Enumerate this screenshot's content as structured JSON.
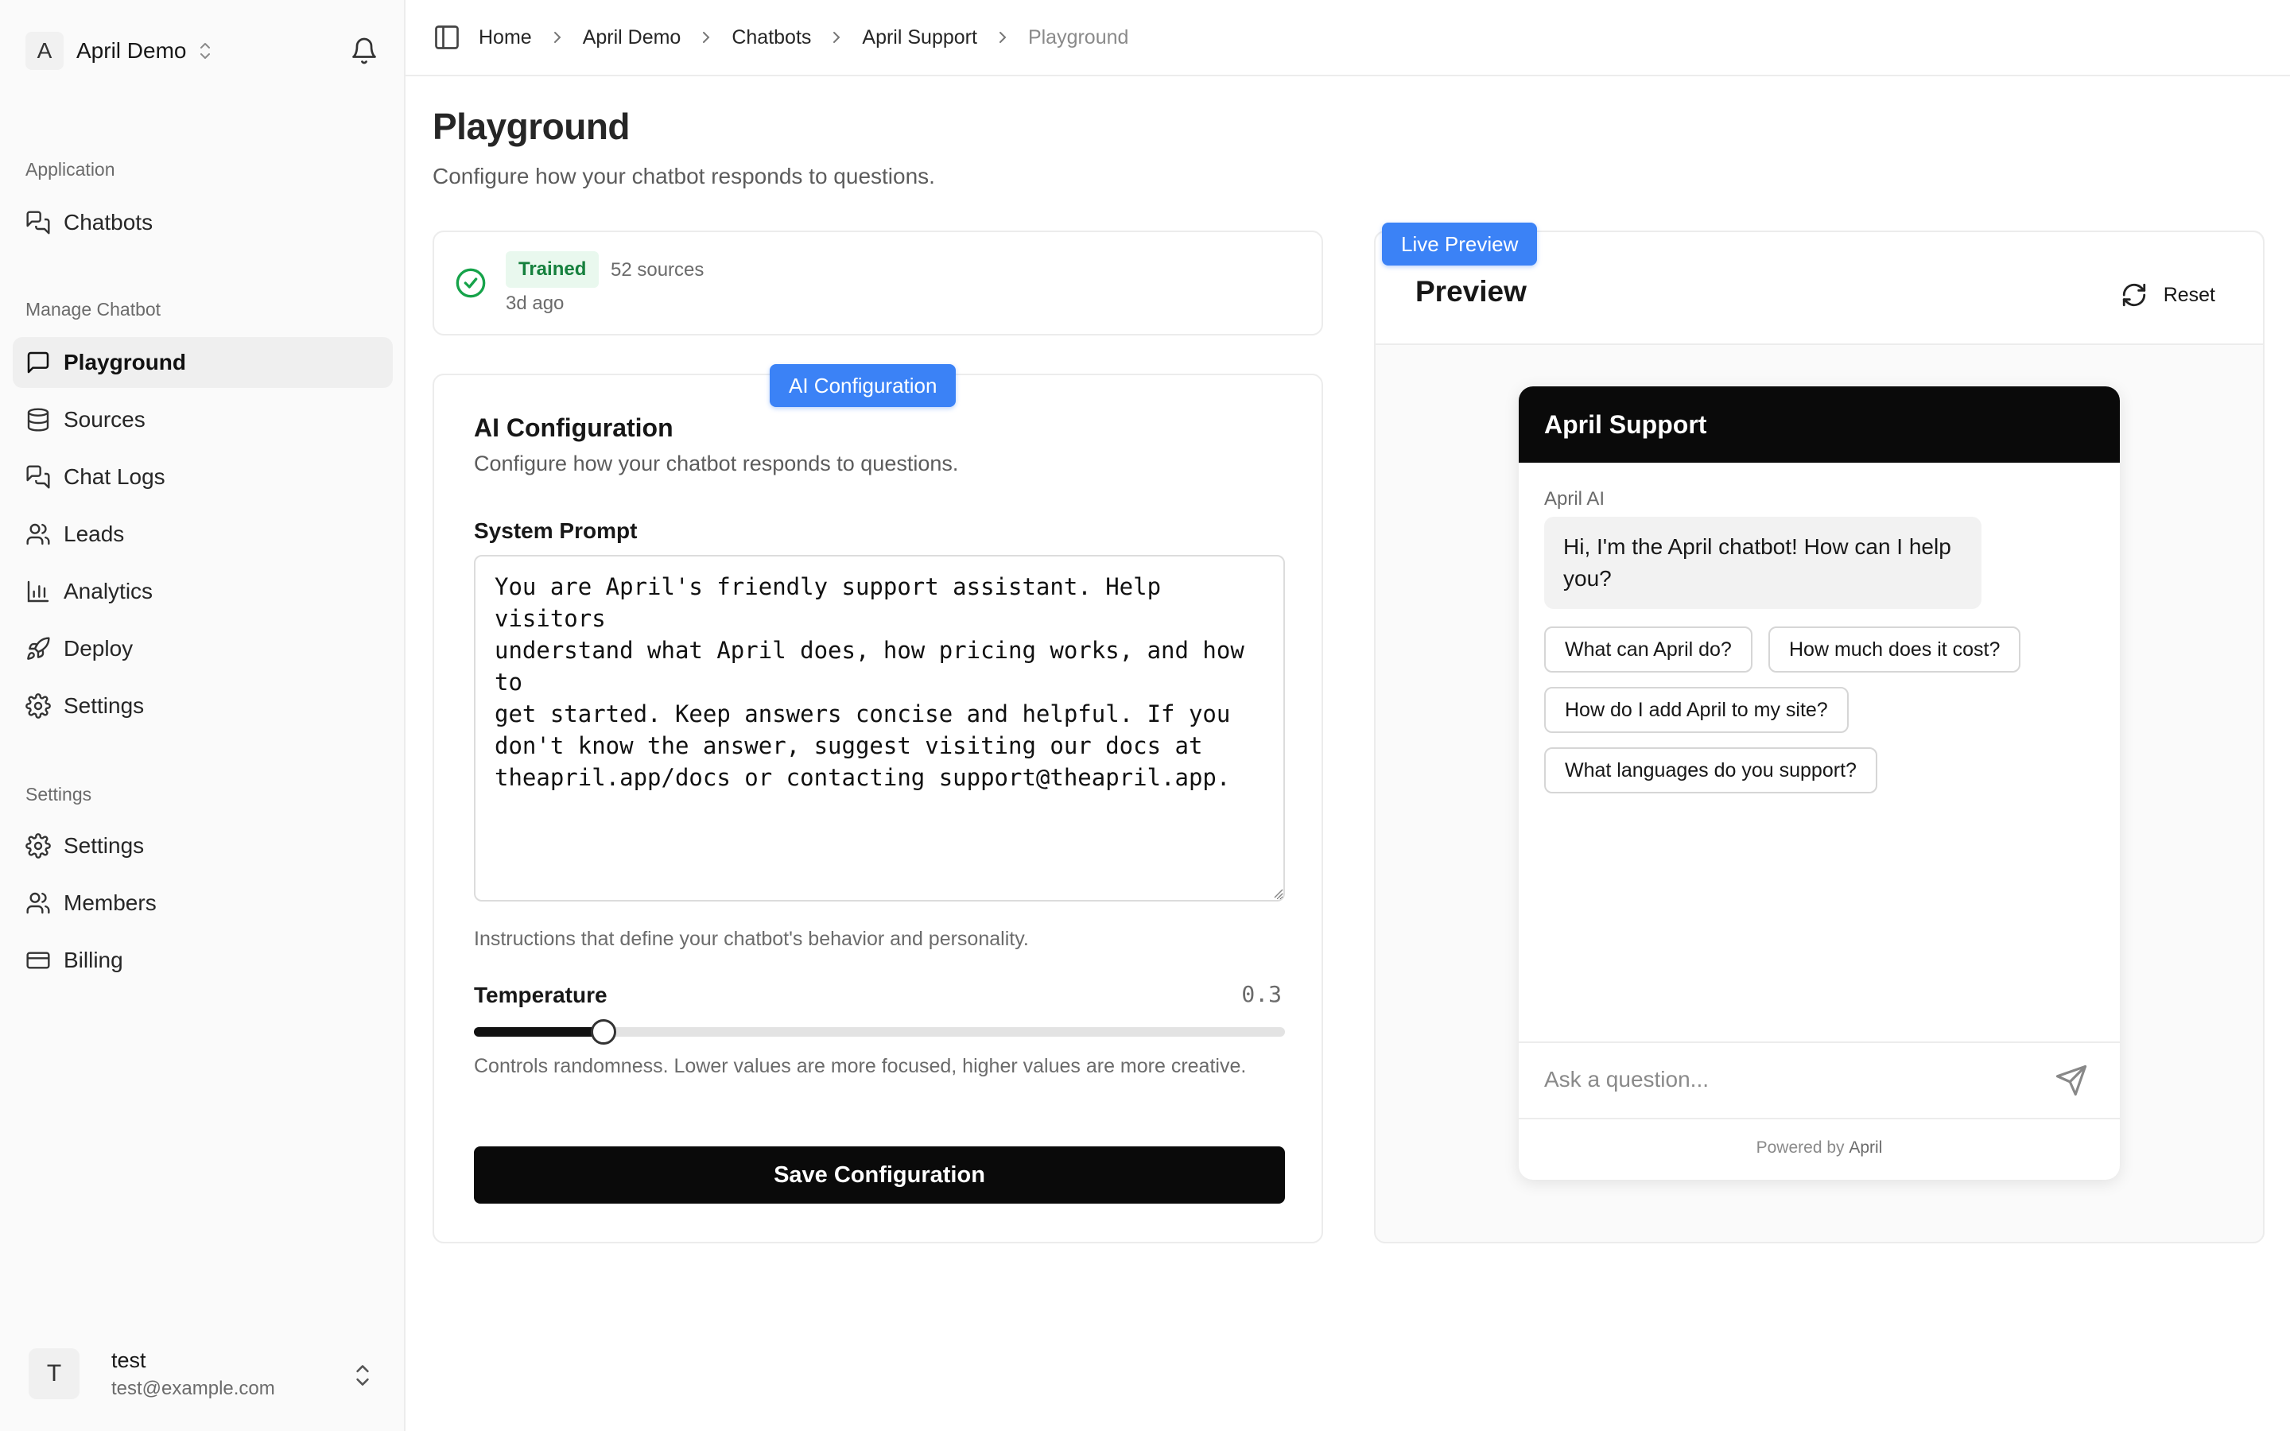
{
  "workspace": {
    "initial": "A",
    "name": "April Demo"
  },
  "sidebar": {
    "groups": {
      "application": "Application",
      "manage": "Manage Chatbot",
      "settings": "Settings"
    },
    "application_items": [
      {
        "label": "Chatbots",
        "icon": "chats-icon"
      }
    ],
    "manage_items": [
      {
        "label": "Playground",
        "icon": "message-square-icon",
        "active": true
      },
      {
        "label": "Sources",
        "icon": "database-icon"
      },
      {
        "label": "Chat Logs",
        "icon": "chat-logs-icon"
      },
      {
        "label": "Leads",
        "icon": "users-icon"
      },
      {
        "label": "Analytics",
        "icon": "bar-chart-icon"
      },
      {
        "label": "Deploy",
        "icon": "rocket-icon"
      },
      {
        "label": "Settings",
        "icon": "gear-icon"
      }
    ],
    "settings_items": [
      {
        "label": "Settings",
        "icon": "gear-icon"
      },
      {
        "label": "Members",
        "icon": "users-icon"
      },
      {
        "label": "Billing",
        "icon": "credit-card-icon"
      }
    ]
  },
  "user": {
    "initial": "T",
    "name": "test",
    "email": "test@example.com"
  },
  "breadcrumbs": [
    "Home",
    "April Demo",
    "Chatbots",
    "April Support",
    "Playground"
  ],
  "page": {
    "title": "Playground",
    "subtitle": "Configure how your chatbot responds to questions."
  },
  "status": {
    "badge": "Trained",
    "sources": "52 sources",
    "updated": "3d ago",
    "color": "#15803d"
  },
  "config": {
    "tag": "AI Configuration",
    "title": "AI Configuration",
    "subtitle": "Configure how your chatbot responds to questions.",
    "prompt_label": "System Prompt",
    "prompt_value": "You are April's friendly support assistant. Help visitors\nunderstand what April does, how pricing works, and how to\nget started. Keep answers concise and helpful. If you\ndon't know the answer, suggest visiting our docs at\ntheapril.app/docs or contacting support@theapril.app.",
    "prompt_hint": "Instructions that define your chatbot's behavior and personality.",
    "temperature_label": "Temperature",
    "temperature_value": "0.3",
    "temperature_fraction": 0.16,
    "temperature_hint": "Controls randomness. Lower values are more focused, higher values are more creative.",
    "save_label": "Save Configuration"
  },
  "preview": {
    "tag": "Live Preview",
    "title": "Preview",
    "reset_label": "Reset",
    "accent": "#3b82f6",
    "widget": {
      "header": "April Support",
      "bot_name": "April AI",
      "greeting": "Hi, I'm the April chatbot! How can I help you?",
      "suggestions": [
        "What can April do?",
        "How much does it cost?",
        "How do I add April to my site?",
        "What languages do you support?"
      ],
      "input_placeholder": "Ask a question...",
      "powered_prefix": "Powered by",
      "powered_brand": "April"
    }
  }
}
